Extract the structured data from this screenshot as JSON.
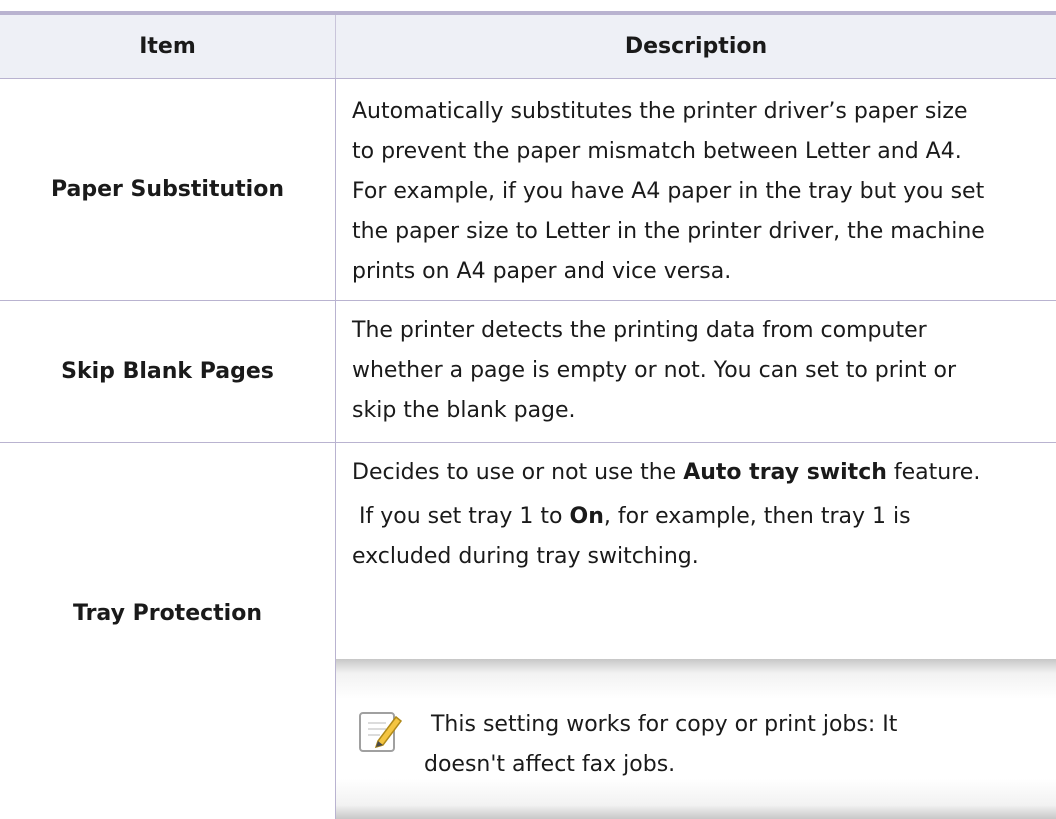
{
  "header": {
    "item": "Item",
    "description": "Description"
  },
  "rows": [
    {
      "item": "Paper Substitution",
      "lines": [
        "Automatically substitutes the printer driver’s paper size",
        "to prevent the paper mismatch between Letter and A4.",
        "For example, if you have A4 paper in the tray but you set",
        "the paper size to Letter in the printer driver, the machine",
        "prints on A4 paper and vice versa."
      ]
    },
    {
      "item": "Skip Blank Pages",
      "lines": [
        "The printer detects the printing data from computer",
        "whether a page is empty or not. You can set to print or",
        "skip the blank page."
      ]
    },
    {
      "item": "Tray Protection",
      "p1": {
        "before": "Decides to use or not use the ",
        "bold": "Auto tray switch",
        "after": " feature."
      },
      "p2": {
        "before": " If you set tray 1 to ",
        "bold": "On",
        "after": ", for example, then tray 1 is"
      },
      "p2_line2": "excluded during tray switching.",
      "note": {
        "icon": "note-pencil-icon",
        "line1": " This setting works for copy or print jobs: It",
        "line2": "doesn't affect fax jobs."
      }
    }
  ]
}
